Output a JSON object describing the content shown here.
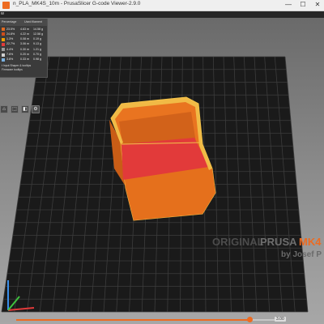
{
  "window": {
    "title": "n_PLA_MK4S_10m - PrusaSlicer G-code Viewer-2.9.0",
    "subtitle": "w"
  },
  "window_controls": {
    "minimize": "—",
    "maximize": "☐",
    "close": "✕"
  },
  "legend": {
    "columns": [
      "Percentage",
      "Used filament"
    ],
    "rows": [
      {
        "color": "#e06b22",
        "pct": "23.5%",
        "len": "4.63 m",
        "wt": "14.58 g"
      },
      {
        "color": "#cf4d1b",
        "pct": "24.8%",
        "len": "4.22 m",
        "wt": "12.58 g"
      },
      {
        "color": "#f0a000",
        "pct": "1.3%",
        "len": "0.08 m",
        "wt": "0.19 g"
      },
      {
        "color": "#e23a3a",
        "pct": "22.7%",
        "len": "3.06 m",
        "wt": "9.13 g"
      },
      {
        "color": "#9a9a9a",
        "pct": "4.4%",
        "len": "0.30 m",
        "wt": "1.21 g"
      },
      {
        "color": "#d0d0d0",
        "pct": "7.6%",
        "len": "0.20 m",
        "wt": "0.70 g"
      },
      {
        "color": "#7ab1e0",
        "pct": "3.8%",
        "len": "0.33 m",
        "wt": "0.98 g"
      }
    ],
    "note1": "t Input Shaper & tooltips",
    "note2": "Firmware tooltips"
  },
  "toolbar": [
    "⌂",
    "⬚",
    "◧",
    "⚙"
  ],
  "bed": {
    "brand_original": "ORIGINAL",
    "brand_prusa": "PRUSA",
    "brand_model": "MK4",
    "tagline": "by Josef P"
  },
  "colors": {
    "accent": "#ed6b21",
    "bed": "#1a1a1a",
    "grid": "#3c3c3c",
    "model_wall": "#e97420",
    "model_floor": "#e23a3a",
    "model_edge": "#f2c24a"
  },
  "layer_slider": {
    "value_label": "3.00",
    "progress": 0.93
  }
}
